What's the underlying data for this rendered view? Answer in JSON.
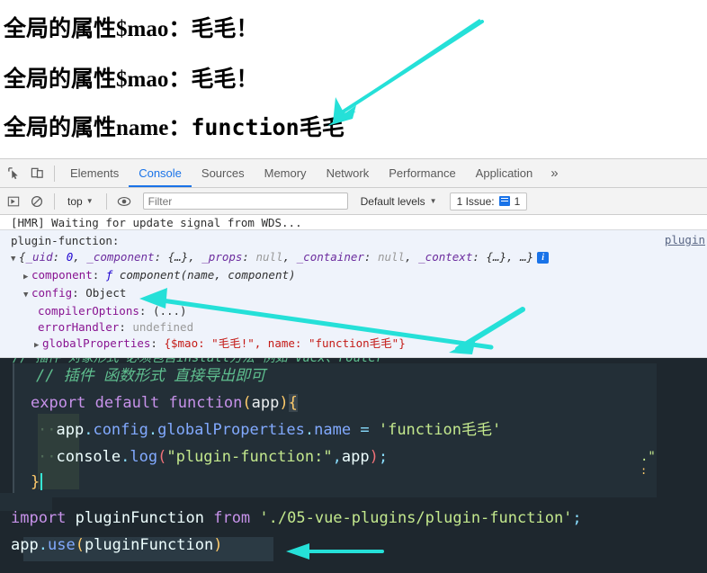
{
  "page_output": {
    "lines": [
      {
        "prefix": "全局的属性$mao：",
        "value": "毛毛！",
        "mono": false
      },
      {
        "prefix": "全局的属性$mao：",
        "value": "毛毛！",
        "mono": false
      },
      {
        "prefix": "全局的属性name：",
        "value": "function毛毛",
        "mono": true
      }
    ]
  },
  "devtools": {
    "icons": {
      "inspect": "inspect-element-icon",
      "device": "device-toolbar-icon",
      "more": "»"
    },
    "tabs": [
      {
        "label": "Elements",
        "active": false
      },
      {
        "label": "Console",
        "active": true
      },
      {
        "label": "Sources",
        "active": false
      },
      {
        "label": "Memory",
        "active": false
      },
      {
        "label": "Network",
        "active": false
      },
      {
        "label": "Performance",
        "active": false
      },
      {
        "label": "Application",
        "active": false
      }
    ],
    "filterbar": {
      "execute_icon": "execute-snippet-icon",
      "clear_icon": "clear-console-icon",
      "context": "top",
      "eye_icon": "live-expression-icon",
      "filter_placeholder": "Filter",
      "filter_value": "",
      "levels": "Default levels",
      "issues_label": "1 Issue:",
      "issues_count": "1"
    },
    "console": {
      "hmr_line": "[HMR] Waiting for update signal from WDS...",
      "source_link": "plugin",
      "message_label": "plugin-function:",
      "object_summary": {
        "k1": "_uid",
        "v1": "0",
        "k2": "_component",
        "v2": "{…}",
        "k3": "_props",
        "v3": "null",
        "k4": "_container",
        "v4": "null",
        "k5": "_context",
        "v5": "{…}",
        "tail": "…}"
      },
      "rows": [
        {
          "key": "component",
          "value": "component(name, component)",
          "kind": "function"
        },
        {
          "key": "config",
          "value": "Object",
          "kind": "object"
        },
        {
          "key": "compilerOptions",
          "value": "(...)",
          "kind": "getter"
        },
        {
          "key": "errorHandler",
          "value": "undefined",
          "kind": "undefined"
        },
        {
          "key": "globalProperties",
          "value": "{$mao: \"毛毛!\", name: \"function毛毛\"}",
          "kind": "inline-object"
        }
      ]
    }
  },
  "editor": {
    "clipped_top_line": "// 插件 对象形式 必须包含install方法 例如 vuex、router",
    "lines": [
      {
        "id": "comment",
        "text": "// 插件 函数形式 直接导出即可"
      },
      {
        "id": "export",
        "text": "export default function(app){"
      },
      {
        "id": "assign",
        "text": "app.config.globalProperties.name = 'function毛毛'"
      },
      {
        "id": "log",
        "text": "console.log(\"plugin-function:\",app);"
      },
      {
        "id": "close",
        "text": "}"
      }
    ],
    "strings": {
      "assign_value": "'function毛毛'",
      "log_arg": "\"plugin-function:\""
    },
    "bottom_lines": [
      {
        "id": "import",
        "text": "import pluginFunction from './05-vue-plugins/plugin-function';"
      },
      {
        "id": "use",
        "text": "app.use(pluginFunction)"
      }
    ]
  },
  "annotations": {
    "arrow_color": "#25e0d8",
    "arrows": [
      {
        "name": "arrow-to-function-name"
      },
      {
        "name": "arrow-to-config"
      },
      {
        "name": "arrow-to-global-properties"
      },
      {
        "name": "arrow-to-app-use"
      }
    ]
  }
}
